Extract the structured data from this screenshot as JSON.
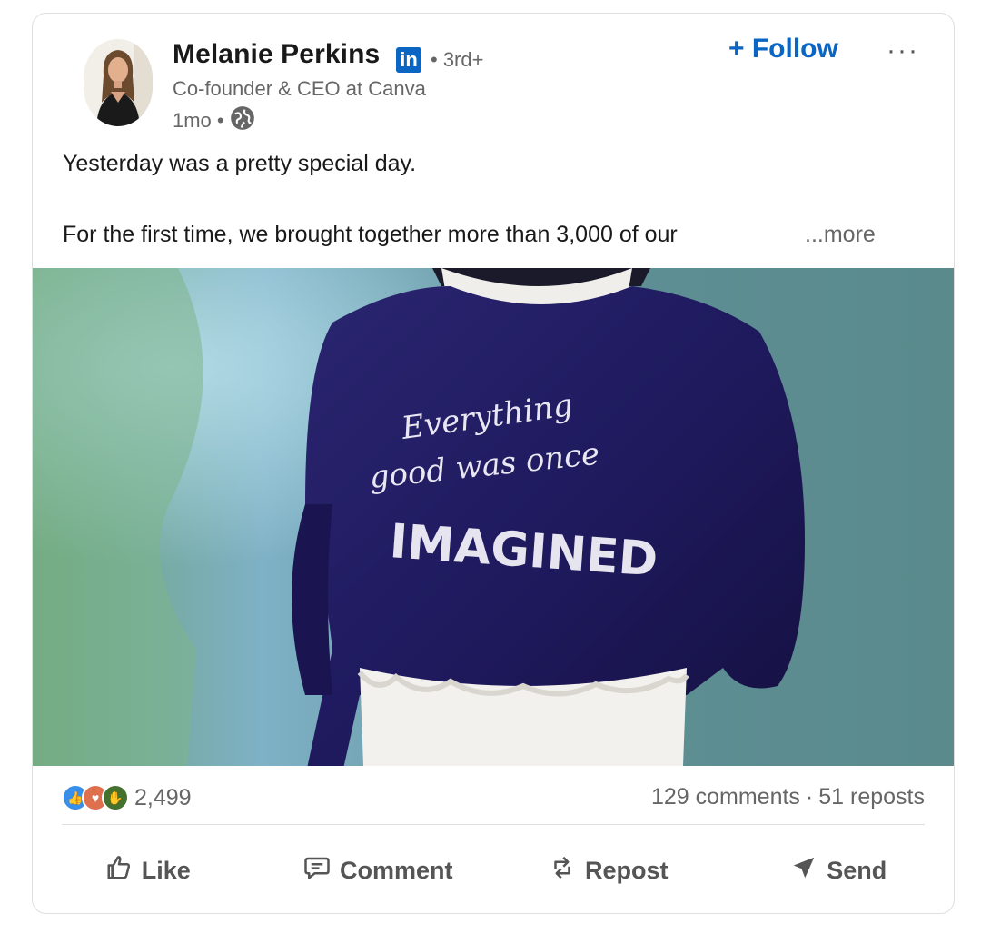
{
  "post": {
    "author": {
      "name": "Melanie Perkins",
      "badge": "in",
      "degree": "• 3rd+",
      "headline": "Co-founder & CEO at Canva",
      "time": "1mo •"
    },
    "follow_label": "+ Follow",
    "more_label": "···",
    "text_line1": "Yesterday was a pretty special day.",
    "text_line2": "For the first time, we brought together more than 3,000 of our",
    "see_more": "...more",
    "image": {
      "line1": "Everything",
      "line2": "good was once",
      "line3": "IMAGINED"
    },
    "stats": {
      "reaction_count": "2,499",
      "comments": "129 comments",
      "separator": "·",
      "reposts": "51 reposts"
    },
    "actions": {
      "like": "Like",
      "comment": "Comment",
      "repost": "Repost",
      "send": "Send"
    }
  },
  "colors": {
    "accent": "#0a66c2",
    "sweater": "#1f1a5e",
    "background_teal": "#5f8f91"
  },
  "icons": [
    "linkedin-badge-icon",
    "globe-icon",
    "like-icon",
    "comment-icon",
    "repost-icon",
    "send-icon",
    "celebrate-icon",
    "love-icon",
    "support-icon"
  ]
}
